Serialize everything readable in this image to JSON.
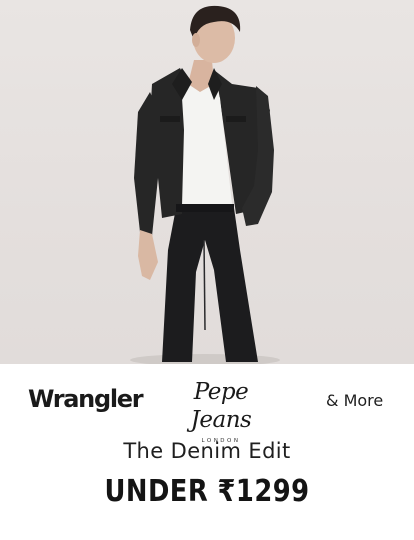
{
  "banner": {
    "brands": [
      {
        "label": "Wrangler",
        "tagline": ""
      },
      {
        "label": "Pepe Jeans",
        "tagline": "LONDON"
      }
    ],
    "more_label": "& More",
    "subtitle": "The Denim Edit",
    "offer": "UNDER ₹1299"
  },
  "colors": {
    "hero_background": "#e6e2df",
    "jacket": "#262626",
    "jeans": "#1c1c1e",
    "tshirt": "#f4f4f2",
    "text": "#1a1a1a"
  }
}
